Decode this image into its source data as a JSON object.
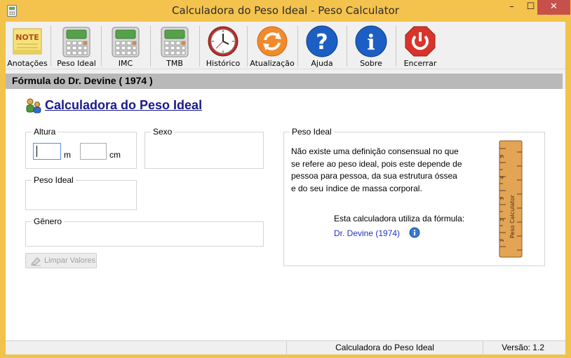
{
  "window": {
    "title": "Calculadora do Peso Ideal - Peso Calculator",
    "minimize": "–",
    "maximize": "☐",
    "close": "✕"
  },
  "toolbar": {
    "items": [
      {
        "label": "Anotações",
        "icon": "note-icon"
      },
      {
        "label": "Peso Ideal",
        "icon": "calculator-icon"
      },
      {
        "label": "IMC",
        "icon": "calculator-icon"
      },
      {
        "label": "TMB",
        "icon": "calculator-icon"
      },
      {
        "label": "Histórico",
        "icon": "clock-icon"
      },
      {
        "label": "Atualização",
        "icon": "refresh-icon"
      },
      {
        "label": "Ajuda",
        "icon": "help-icon"
      },
      {
        "label": "Sobre",
        "icon": "info-icon"
      },
      {
        "label": "Encerrar",
        "icon": "power-icon"
      }
    ],
    "note_text": "NOTE"
  },
  "formula_band": "Fórmula do Dr. Devine ( 1974 )",
  "main": {
    "title": "Calculadora do Peso Ideal",
    "altura": {
      "legend": "Altura",
      "meters_value": "",
      "meters_unit": "m",
      "cm_value": "",
      "cm_unit": "cm"
    },
    "sexo": {
      "legend": "Sexo"
    },
    "peso_ideal": {
      "legend": "Peso Ideal"
    },
    "genero": {
      "legend": "Gênero"
    },
    "clear_button": "Limpar Valores",
    "info_panel": {
      "legend": "Peso Ideal",
      "description_lines": [
        "Não existe uma definição consensual no que",
        "se refere ao peso ideal, pois este depende de",
        "pessoa para pessoa, da sua estrutura óssea",
        "e do seu índice de massa corporal."
      ],
      "uses_formula": "Esta calculadora utiliza da fórmula:",
      "formula_link": "Dr. Devine (1974)",
      "ruler_text": "Peso Calculator",
      "ruler_numbers": [
        "5",
        "4",
        "3",
        "2",
        "1"
      ]
    }
  },
  "statusbar": {
    "center": "Calculadora do Peso Ideal",
    "version": "Versão: 1.2"
  },
  "colors": {
    "title_bar": "#f4c34d",
    "close_button": "#c7504a",
    "link": "#1a1a8c",
    "formula_band": "#b9b9b9"
  }
}
